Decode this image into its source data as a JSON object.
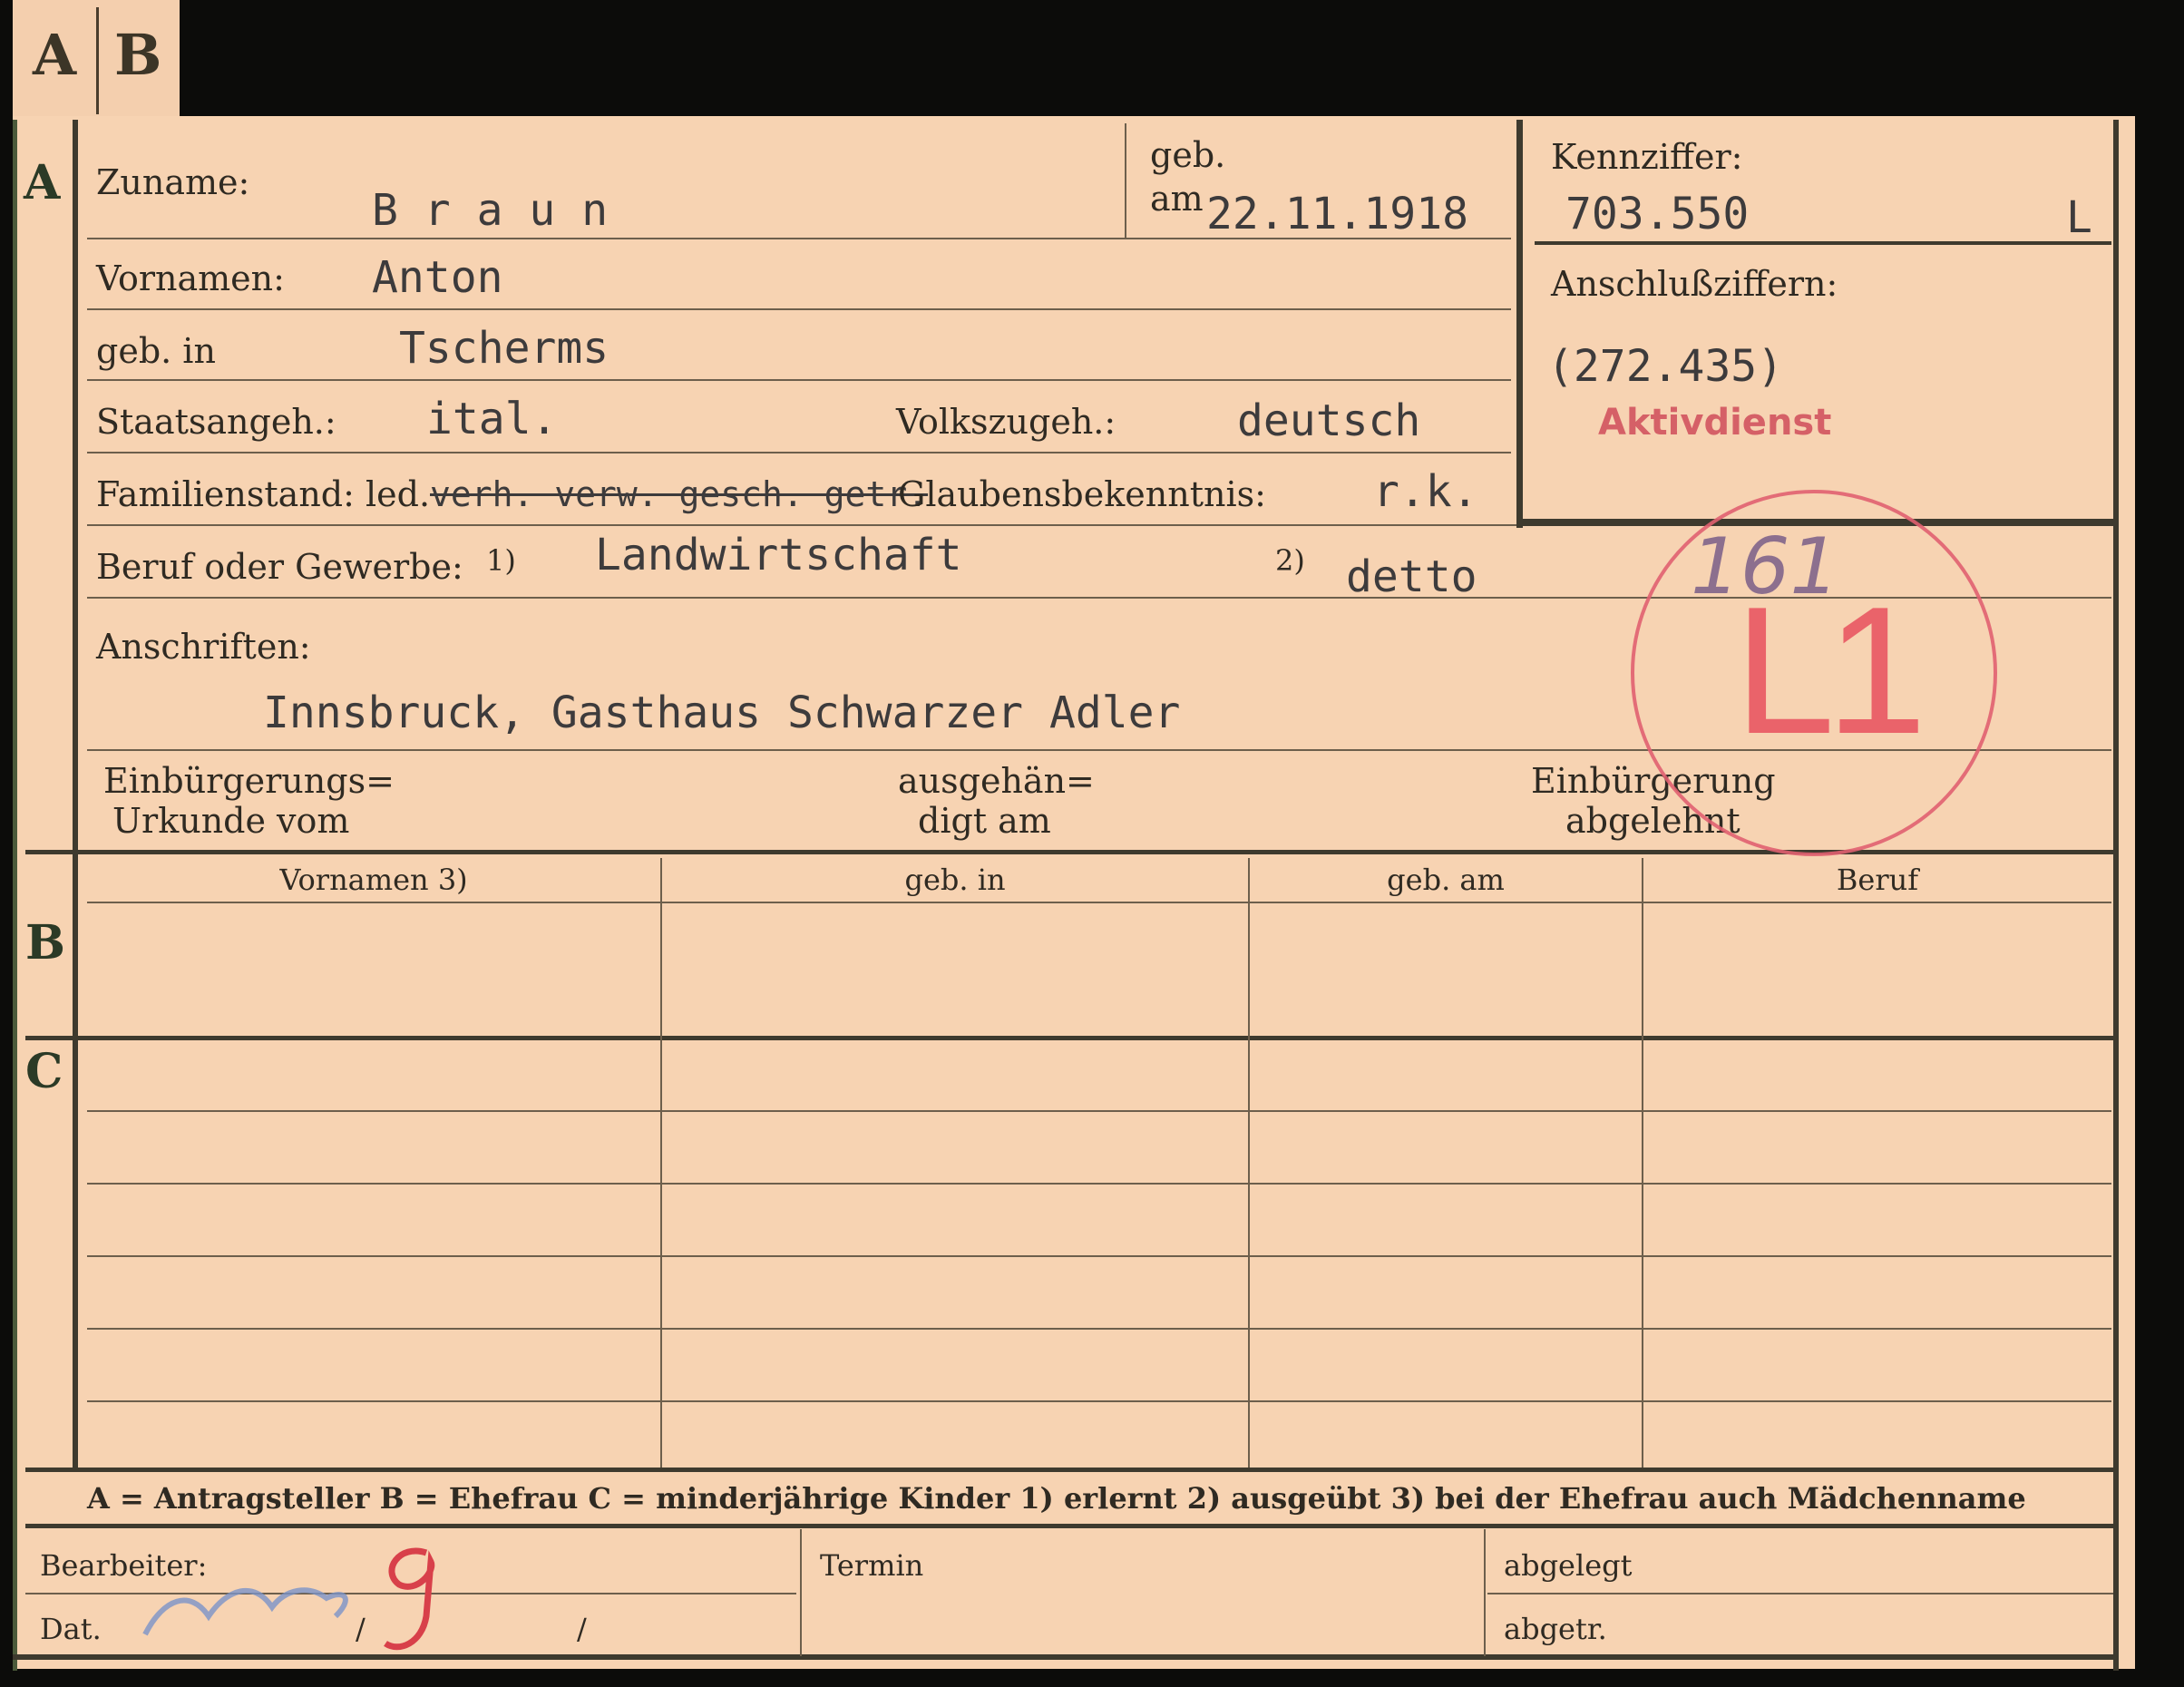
{
  "tabs": {
    "a": "A",
    "b": "B"
  },
  "sections": {
    "a": "A",
    "b": "B",
    "c": "C"
  },
  "fields": {
    "zuname_label": "Zuname:",
    "zuname_value": "B r a u n",
    "geb_am_label_1": "geb.",
    "geb_am_label_2": "am",
    "geb_am_value": "22.11.1918",
    "kennziffer_label": "Kennziffer:",
    "kennziffer_value": "703.550",
    "kennziffer_suffix": "L",
    "anschluss_label": "Anschlußziffern:",
    "anschluss_value": "(272.435)",
    "anschluss_stamp": "Aktivdienst",
    "vornamen_label": "Vornamen:",
    "vornamen_value": "Anton",
    "geb_in_label": "geb. in",
    "geb_in_value": "Tscherms",
    "staatsangeh_label": "Staatsangeh.:",
    "staatsangeh_value": "ital.",
    "volkszugeh_label": "Volkszugeh.:",
    "volkszugeh_value": "deutsch",
    "familienstand_label": "Familienstand: led.",
    "familienstand_struck": "verh. verw. gesch. getr.",
    "glaubens_label": "Glaubensbekenntnis:",
    "glaubens_value": "r.k.",
    "beruf_label": "Beruf oder Gewerbe:",
    "beruf_note1": "1)",
    "beruf_value1": "Landwirtschaft",
    "beruf_note2": "2)",
    "beruf_value2": "detto",
    "anschriften_label": "Anschriften:",
    "anschriften_value": "Innsbruck, Gasthaus Schwarzer Adler",
    "einb_urk_label_1": "Einbürgerungs=",
    "einb_urk_label_2": "Urkunde vom",
    "ausgeh_label_1": "ausgehän=",
    "ausgeh_label_2": "digt am",
    "einb_abg_label_1": "Einbürgerung",
    "einb_abg_label_2": "abgelehnt"
  },
  "stamp": {
    "mark": "L1",
    "handwritten": "161",
    "color": "#e8505e"
  },
  "table": {
    "headers": [
      "Vornamen 3)",
      "geb. in",
      "geb. am",
      "Beruf"
    ]
  },
  "legend": "A = Antragsteller   B = Ehefrau   C = minderjährige Kinder   1) erlernt   2) ausgeübt   3) bei der Ehefrau auch Mädchenname",
  "footer": {
    "bearbeiter_label": "Bearbeiter:",
    "dat_label": "Dat.",
    "dat_sep1": "/",
    "dat_sep2": "/",
    "termin_label": "Termin",
    "abgelegt_label": "abgelegt",
    "abgetr_label": "abgetr."
  }
}
